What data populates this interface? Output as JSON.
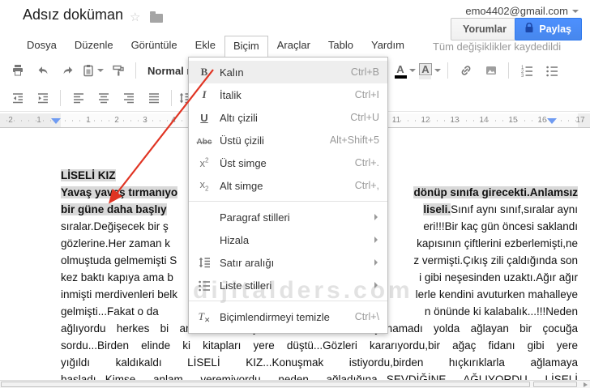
{
  "titlebar": {
    "title": "Adsız doküman",
    "account_email": "emo4402@gmail.com"
  },
  "actions": {
    "comments_label": "Yorumlar",
    "share_label": "Paylaş"
  },
  "menubar": {
    "items": [
      {
        "id": "dosya",
        "label": "Dosya"
      },
      {
        "id": "duzenle",
        "label": "Düzenle"
      },
      {
        "id": "goruntule",
        "label": "Görüntüle"
      },
      {
        "id": "ekle",
        "label": "Ekle"
      },
      {
        "id": "bicim",
        "label": "Biçim",
        "open": true
      },
      {
        "id": "araclar",
        "label": "Araçlar"
      },
      {
        "id": "tablo",
        "label": "Tablo"
      },
      {
        "id": "yardim",
        "label": "Yardım"
      }
    ],
    "saved_status": "Tüm değişiklikler kaydedildi"
  },
  "toolbar": {
    "row1_left": [
      {
        "name": "print"
      },
      {
        "name": "undo"
      },
      {
        "name": "redo"
      },
      {
        "name": "paste-format",
        "caret": true
      },
      {
        "name": "paint-format"
      },
      {
        "name": "sep"
      },
      {
        "name": "styles",
        "label": "Normal me..."
      }
    ],
    "row1_right": [
      {
        "name": "text-color",
        "caret": true
      },
      {
        "name": "highlight-color",
        "caret": true
      },
      {
        "name": "sep"
      },
      {
        "name": "insert-link"
      },
      {
        "name": "insert-image"
      },
      {
        "name": "sep"
      },
      {
        "name": "numbered-list"
      },
      {
        "name": "bullet-list"
      }
    ],
    "row2": [
      {
        "name": "outdent"
      },
      {
        "name": "indent"
      },
      {
        "name": "sep"
      },
      {
        "name": "align-left"
      },
      {
        "name": "align-center"
      },
      {
        "name": "align-right"
      },
      {
        "name": "align-justify"
      },
      {
        "name": "sep"
      },
      {
        "name": "line-spacing",
        "caret": true
      }
    ]
  },
  "format_menu": {
    "items": [
      {
        "id": "kalin",
        "glyph": "bold",
        "label": "Kalın",
        "shortcut": "Ctrl+B",
        "hover": true
      },
      {
        "id": "italik",
        "glyph": "italic",
        "label": "İtalik",
        "shortcut": "Ctrl+I"
      },
      {
        "id": "alti-cizili",
        "glyph": "underline",
        "label": "Altı çizili",
        "shortcut": "Ctrl+U"
      },
      {
        "id": "ustu-cizili",
        "glyph": "strikethrough",
        "label": "Üstü çizili",
        "shortcut": "Alt+Shift+5"
      },
      {
        "id": "ust-simge",
        "glyph": "superscript",
        "label": "Üst simge",
        "shortcut": "Ctrl+."
      },
      {
        "id": "alt-simge",
        "glyph": "subscript",
        "label": "Alt simge",
        "shortcut": "Ctrl+,"
      },
      {
        "id": "paragraf-stilleri",
        "glyph": "",
        "label": "Paragraf stilleri",
        "submenu": true,
        "divider_before": true
      },
      {
        "id": "hizala",
        "glyph": "",
        "label": "Hizala",
        "submenu": true
      },
      {
        "id": "satir-araligi",
        "glyph": "line-spacing",
        "label": "Satır aralığı",
        "submenu": true
      },
      {
        "id": "liste-stilleri",
        "glyph": "bullet-list",
        "label": "Liste stilleri",
        "submenu": true
      },
      {
        "id": "bicimlendirmeyi-temizle",
        "glyph": "clear-format",
        "label": "Biçimlendirmeyi temizle",
        "shortcut": "Ctrl+\\",
        "divider_before": true
      }
    ]
  },
  "ruler": {
    "numbers": [
      "2",
      "1",
      "1",
      "2",
      "3",
      "4",
      "11",
      "12",
      "13",
      "14",
      "15",
      "16",
      "17"
    ]
  },
  "document": {
    "lines": [
      {
        "left": [
          {
            "t": "LİSELİ KIZ",
            "b": true,
            "h": true
          }
        ]
      },
      {
        "left": [
          {
            "t": "Yavaş yavaş tırmanıyo",
            "b": true,
            "h": true
          }
        ],
        "right": [
          {
            "t": "dönüp sınıfa girecekti.Anlamsız",
            "b": true,
            "h": true
          }
        ]
      },
      {
        "left": [
          {
            "t": "bir güne daha başlıy",
            "b": true,
            "h": true
          }
        ],
        "right": [
          {
            "t": "liseli.",
            "b": true,
            "h": true
          },
          {
            "t": "Sınıf aynı sınıf,sıralar aynı"
          }
        ]
      },
      {
        "left": [
          {
            "t": "sıralar.Değişecek bir ş"
          }
        ],
        "right": [
          {
            "t": "eri!!!Bir kaç gün öncesi saklandı"
          }
        ]
      },
      {
        "left": [
          {
            "t": "gözlerine.Her zaman k"
          }
        ],
        "right": [
          {
            "t": "kapısının çiftlerini ezberlemişti,ne"
          }
        ]
      },
      {
        "left": [
          {
            "t": "olmuştuda gelmemişti S"
          }
        ],
        "right": [
          {
            "t": "z vermişti.Çıkış zili çaldığında son"
          }
        ]
      },
      {
        "left": [
          {
            "t": "kez baktı kapıya ama b"
          }
        ],
        "right": [
          {
            "t": "i gibi neşesinden uzaktı.Ağır ağır"
          }
        ]
      },
      {
        "left": [
          {
            "t": "inmişti merdivenleri belk"
          }
        ],
        "right": [
          {
            "t": "lerle kendini avuturken mahalleye"
          }
        ]
      },
      {
        "left": [
          {
            "t": "gelmişti...Fakat o da"
          }
        ],
        "right": [
          {
            "t": "n önünde ki kalabalık...!!!Neden"
          }
        ]
      },
      {
        "full": [
          {
            "t": "ağlıyordu herkes bi anlam veremiyordu LİSELİ KIZ...Dayanamadı yolda ağlayan bir çocuğa"
          }
        ]
      },
      {
        "full": [
          {
            "t": "sordu...Birden elinde ki kitapları yere düştü...Gözleri kararıyordu,bir ağaç fidanı gibi yere"
          }
        ]
      },
      {
        "full": [
          {
            "t": "yığıldı kaldıkaldı LİSELİ KIZ...Konuşmak istiyordu,birden hıçkırıklarla ağlamaya"
          }
        ]
      },
      {
        "full": [
          {
            "t": "başladı...Kimse anlam veremiyordu neden ağladığına...SEVDİĞİNE AĞLIYORDU LİSELİ"
          }
        ]
      }
    ]
  },
  "watermark": {
    "text": "dijitalders.com"
  },
  "colors": {
    "share_blue": "#4d90fe",
    "selection": "#d9d9d9",
    "arrow_red": "#e03423"
  }
}
